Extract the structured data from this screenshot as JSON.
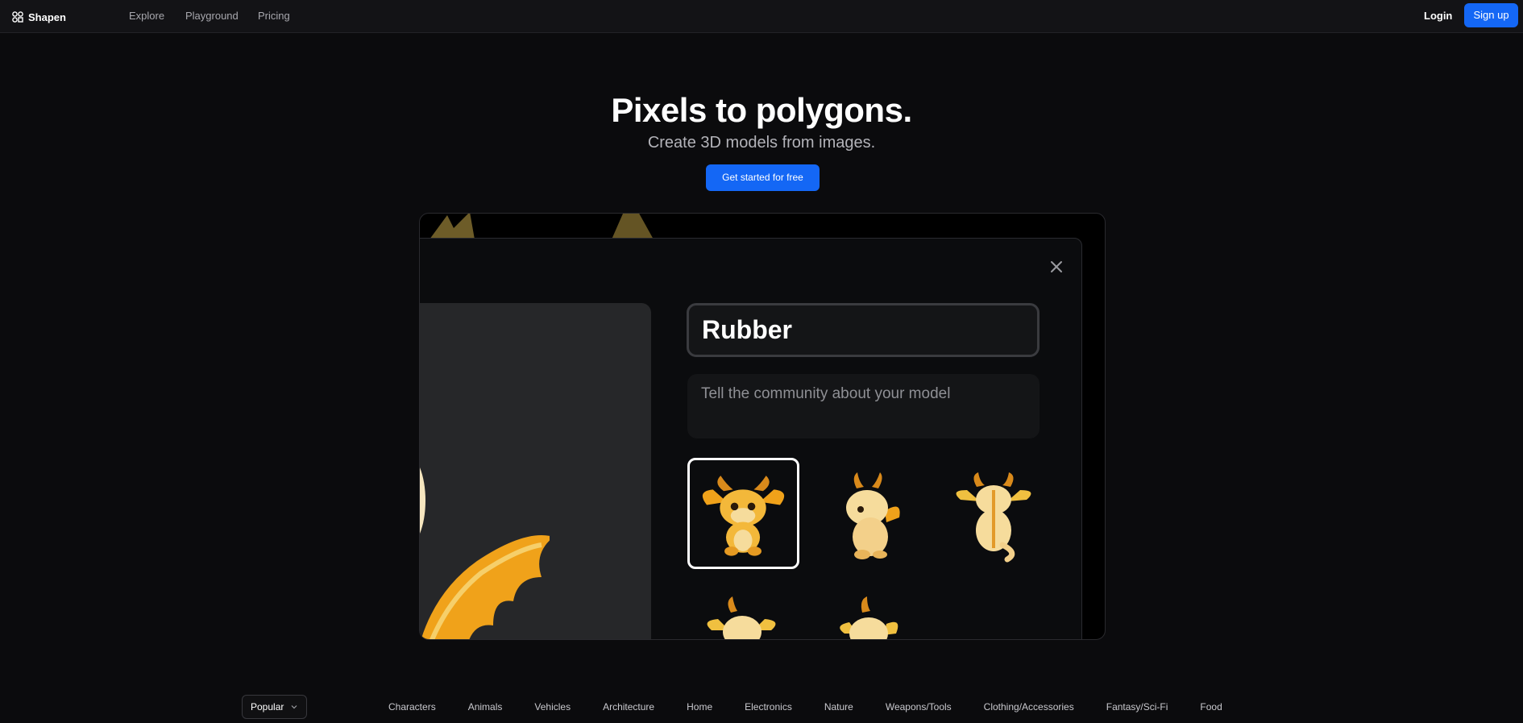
{
  "nav": {
    "brand": "Shapen",
    "links": {
      "explore": "Explore",
      "playground": "Playground",
      "pricing": "Pricing"
    },
    "login": "Login",
    "signup": "Sign up"
  },
  "hero": {
    "title": "Pixels to polygons.",
    "subtitle": "Create 3D models from images.",
    "cta": "Get started for free"
  },
  "demo": {
    "title_value": "Rubber",
    "description_placeholder": "Tell the community about your model",
    "thumbnails_selected_index": 0
  },
  "filters": {
    "sort_selected": "Popular",
    "categories": [
      "Characters",
      "Animals",
      "Vehicles",
      "Architecture",
      "Home",
      "Electronics",
      "Nature",
      "Weapons/Tools",
      "Clothing/Accessories",
      "Fantasy/Sci-Fi",
      "Food"
    ]
  },
  "colors": {
    "accent": "#1467f5",
    "background": "#0b0b0d",
    "nav_background": "#131316",
    "dragon_orange": "#f0a21a",
    "dragon_cream": "#f6dc9c"
  }
}
